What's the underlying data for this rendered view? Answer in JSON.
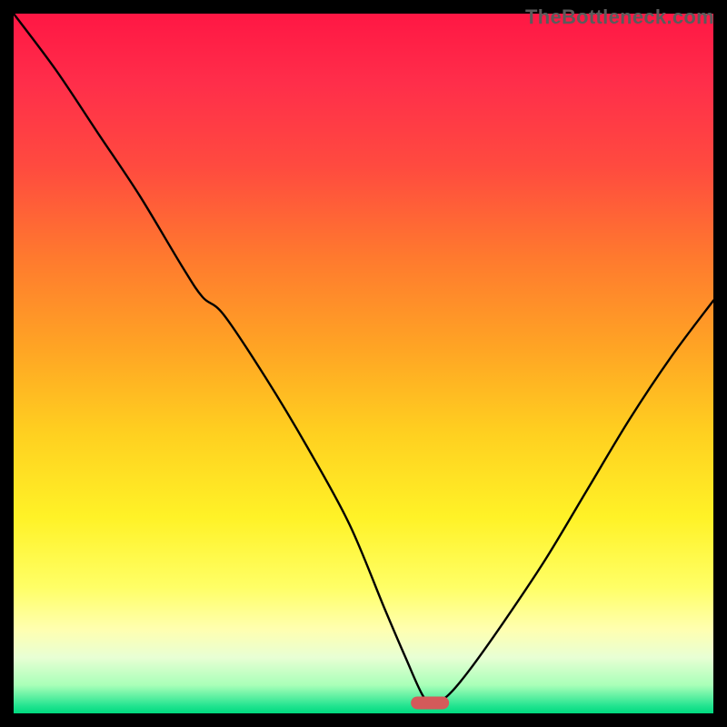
{
  "watermark": "TheBottleneck.com",
  "colors": {
    "background": "#000000",
    "gradient_stops": [
      {
        "offset": 0.0,
        "color": "#ff1744"
      },
      {
        "offset": 0.1,
        "color": "#ff2e4a"
      },
      {
        "offset": 0.22,
        "color": "#ff4b3f"
      },
      {
        "offset": 0.35,
        "color": "#ff7a2e"
      },
      {
        "offset": 0.48,
        "color": "#ffa524"
      },
      {
        "offset": 0.6,
        "color": "#ffd020"
      },
      {
        "offset": 0.72,
        "color": "#fff227"
      },
      {
        "offset": 0.82,
        "color": "#ffff66"
      },
      {
        "offset": 0.88,
        "color": "#ffffb0"
      },
      {
        "offset": 0.92,
        "color": "#e8ffd4"
      },
      {
        "offset": 0.96,
        "color": "#a8ffb8"
      },
      {
        "offset": 0.99,
        "color": "#20e38f"
      },
      {
        "offset": 1.0,
        "color": "#00d97e"
      }
    ],
    "curve_stroke": "#000000",
    "marker_fill": "#d45a5a"
  },
  "chart_data": {
    "type": "line",
    "title": "",
    "xlabel": "",
    "ylabel": "",
    "xlim": [
      0,
      100
    ],
    "ylim": [
      0,
      100
    ],
    "grid": false,
    "series": [
      {
        "name": "bottleneck-curve",
        "x": [
          0,
          6,
          12,
          18,
          24,
          27,
          30,
          36,
          42,
          48,
          53,
          56,
          58.5,
          60,
          62,
          65,
          70,
          76,
          82,
          88,
          94,
          100
        ],
        "values": [
          100,
          92,
          83,
          74,
          64,
          59.5,
          57,
          48,
          38,
          27,
          15,
          8,
          2.5,
          1.5,
          2.5,
          6,
          13,
          22,
          32,
          42,
          51,
          59
        ]
      }
    ],
    "annotations": [
      {
        "name": "optimal-marker",
        "x": 59.5,
        "y": 1.5,
        "shape": "pill"
      }
    ]
  }
}
